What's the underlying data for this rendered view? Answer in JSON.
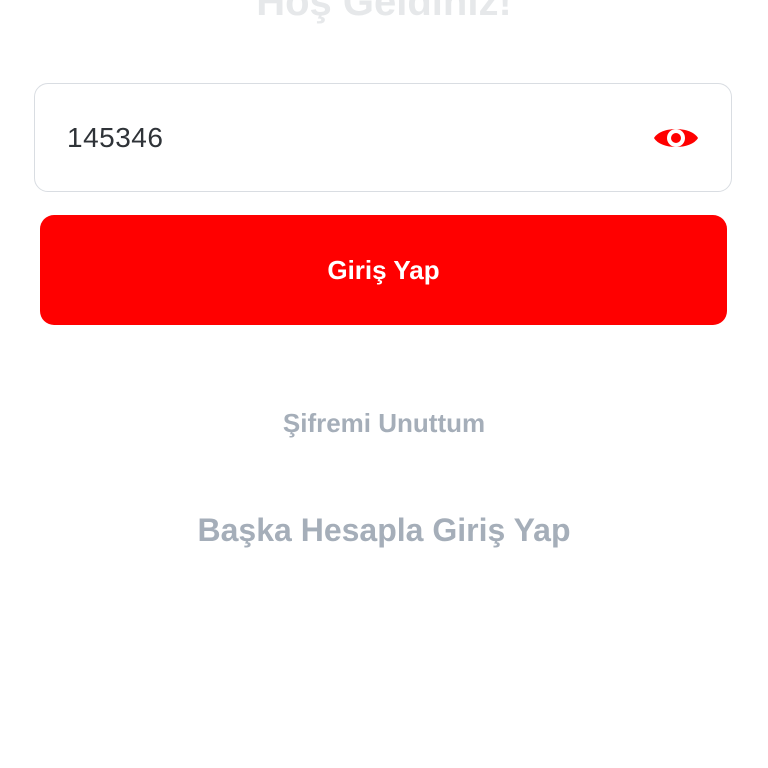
{
  "header": {
    "title": "Hoş Geldiniz!"
  },
  "password_field": {
    "value": "145346",
    "toggle_icon": "eye-icon"
  },
  "login_button": {
    "label": "Giriş Yap"
  },
  "links": {
    "forgot_password": "Şifremi Unuttum",
    "other_account": "Başka Hesapla Giriş Yap"
  },
  "colors": {
    "primary": "#ff0000",
    "link": "#a5aeb9",
    "field_border": "#d9dde2",
    "title": "#e6e8ea",
    "input_text": "#2f3338",
    "background": "#ffffff"
  }
}
